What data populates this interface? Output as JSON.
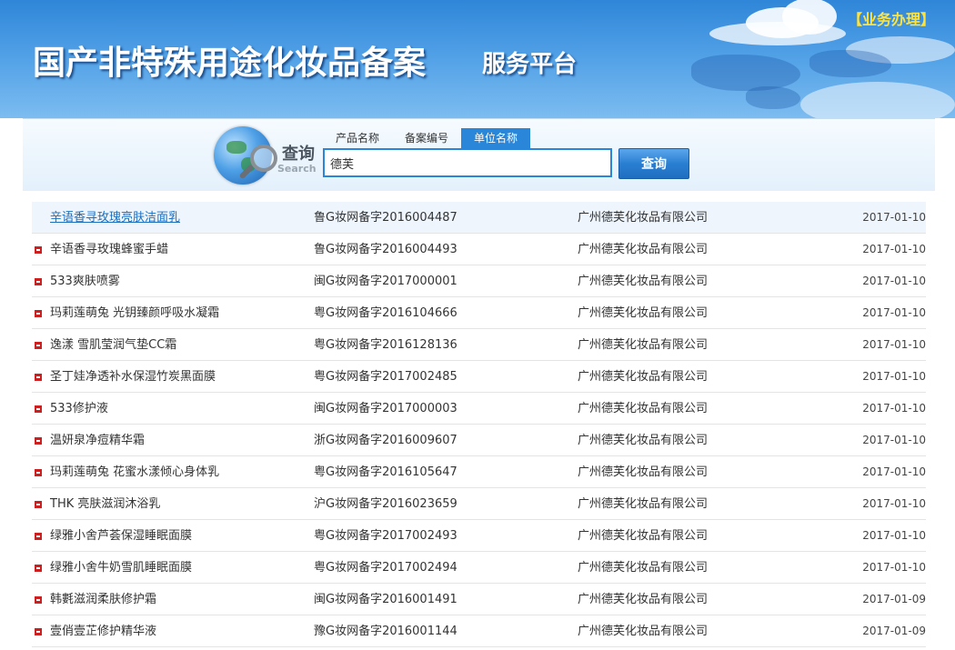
{
  "header": {
    "title": "国产非特殊用途化妆品备案",
    "subtitle": "服务平台",
    "business_link": "【业务办理】"
  },
  "search": {
    "heading": "查询",
    "heading_en": "Search",
    "tabs": [
      "产品名称",
      "备案编号",
      "单位名称"
    ],
    "active_tab": "单位名称",
    "value": "德芙",
    "button_label": "查询"
  },
  "results": [
    {
      "name": "辛语香寻玫瑰亮肤洁面乳",
      "record": "鲁G妆网备字2016004487",
      "company": "广州德芙化妆品有限公司",
      "date": "2017-01-10"
    },
    {
      "name": "辛语香寻玫瑰蜂蜜手蜡",
      "record": "鲁G妆网备字2016004493",
      "company": "广州德芙化妆品有限公司",
      "date": "2017-01-10"
    },
    {
      "name": "533爽肤喷雾",
      "record": "闽G妆网备字2017000001",
      "company": "广州德芙化妆品有限公司",
      "date": "2017-01-10"
    },
    {
      "name": "玛莉莲萌兔 光钥臻颜呼吸水凝霜",
      "record": "粤G妆网备字2016104666",
      "company": "广州德芙化妆品有限公司",
      "date": "2017-01-10"
    },
    {
      "name": "逸漾 雪肌莹润气垫CC霜",
      "record": "粤G妆网备字2016128136",
      "company": "广州德芙化妆品有限公司",
      "date": "2017-01-10"
    },
    {
      "name": "圣丁娃净透补水保湿竹炭黑面膜",
      "record": "粤G妆网备字2017002485",
      "company": "广州德芙化妆品有限公司",
      "date": "2017-01-10"
    },
    {
      "name": "533修护液",
      "record": "闽G妆网备字2017000003",
      "company": "广州德芙化妆品有限公司",
      "date": "2017-01-10"
    },
    {
      "name": "温妍泉净痘精华霜",
      "record": "浙G妆网备字2016009607",
      "company": "广州德芙化妆品有限公司",
      "date": "2017-01-10"
    },
    {
      "name": "玛莉莲萌兔 花蜜水漾倾心身体乳",
      "record": "粤G妆网备字2016105647",
      "company": "广州德芙化妆品有限公司",
      "date": "2017-01-10"
    },
    {
      "name": "THK 亮肤滋润沐浴乳",
      "record": "沪G妆网备字2016023659",
      "company": "广州德芙化妆品有限公司",
      "date": "2017-01-10"
    },
    {
      "name": "绿雅小舍芦荟保湿睡眠面膜",
      "record": "粤G妆网备字2017002493",
      "company": "广州德芙化妆品有限公司",
      "date": "2017-01-10"
    },
    {
      "name": "绿雅小舍牛奶雪肌睡眠面膜",
      "record": "粤G妆网备字2017002494",
      "company": "广州德芙化妆品有限公司",
      "date": "2017-01-10"
    },
    {
      "name": "韩氀滋润柔肤修护霜",
      "record": "闽G妆网备字2016001491",
      "company": "广州德芙化妆品有限公司",
      "date": "2017-01-09"
    },
    {
      "name": "壹俏壹芷修护精华液",
      "record": "豫G妆网备字2016001144",
      "company": "广州德芙化妆品有限公司",
      "date": "2017-01-09"
    }
  ]
}
